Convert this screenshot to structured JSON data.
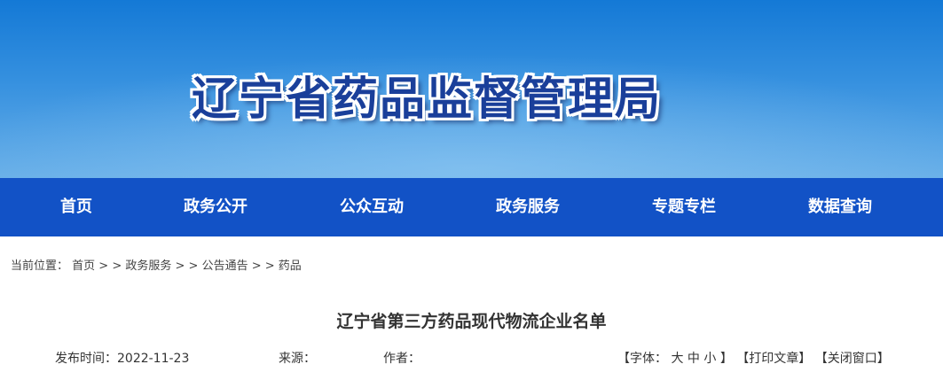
{
  "header": {
    "site_title": "辽宁省药品监督管理局"
  },
  "nav": {
    "items": [
      {
        "label": "首页"
      },
      {
        "label": "政务公开"
      },
      {
        "label": "公众互动"
      },
      {
        "label": "政务服务"
      },
      {
        "label": "专题专栏"
      },
      {
        "label": "数据查询"
      }
    ]
  },
  "breadcrumb": {
    "prefix": "当前位置：",
    "items": [
      "首页",
      "政务服务",
      "公告通告",
      "药品"
    ],
    "separator": " > > "
  },
  "article": {
    "title": "辽宁省第三方药品现代物流企业名单",
    "publish_label": "发布时间：",
    "publish_date": "2022-11-23",
    "source_label": "来源：",
    "author_label": "作者：",
    "font_prefix": "【字体：",
    "font_large": "大",
    "font_medium": "中",
    "font_small": "小",
    "font_suffix": "】",
    "print": "【打印文章】",
    "close": "【关闭窗口】"
  },
  "colors": {
    "banner_top": "#1479d6",
    "banner_bottom": "#68afe8",
    "nav_bg": "#1252c6",
    "title_text": "#1a3f9a"
  }
}
